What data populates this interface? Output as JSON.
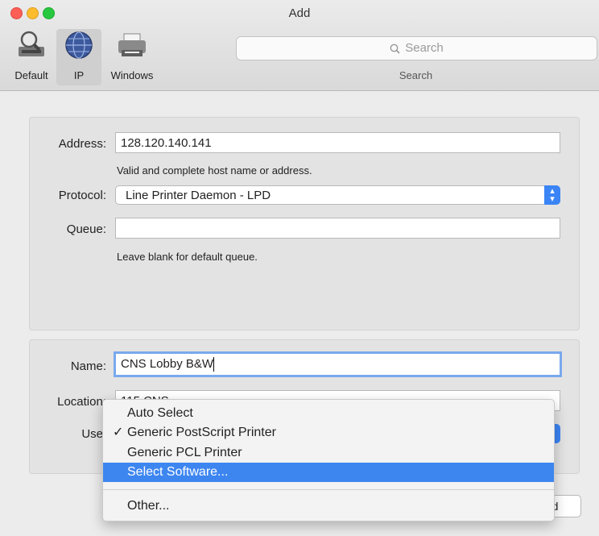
{
  "window": {
    "title": "Add"
  },
  "toolbar": {
    "items": [
      {
        "label": "Default",
        "icon": "default-printer-icon"
      },
      {
        "label": "IP",
        "icon": "globe-icon"
      },
      {
        "label": "Windows",
        "icon": "windows-printer-icon"
      }
    ],
    "search_placeholder": "Search",
    "search_caption": "Search"
  },
  "address": {
    "label": "Address:",
    "value": "128.120.140.141",
    "hint": "Valid and complete host name or address."
  },
  "protocol": {
    "label": "Protocol:",
    "value": "Line Printer Daemon - LPD"
  },
  "queue": {
    "label": "Queue:",
    "value": "",
    "hint": "Leave blank for default queue."
  },
  "name": {
    "label": "Name:",
    "value": "CNS Lobby B&W"
  },
  "location": {
    "label": "Location:",
    "value": "115 CNS"
  },
  "use": {
    "label": "Use"
  },
  "dropdown": {
    "items": [
      {
        "label": "Auto Select",
        "checked": false
      },
      {
        "label": "Generic PostScript Printer",
        "checked": true
      },
      {
        "label": "Generic PCL Printer",
        "checked": false
      },
      {
        "label": "Select Software...",
        "selected": true
      }
    ],
    "other_label": "Other...",
    "check_glyph": "✓"
  },
  "add_button": {
    "label": "Add"
  },
  "colors": {
    "accent": "#3d86f0",
    "close": "#fd5f57",
    "minimize": "#fcbc2e",
    "maximize": "#27c840"
  }
}
